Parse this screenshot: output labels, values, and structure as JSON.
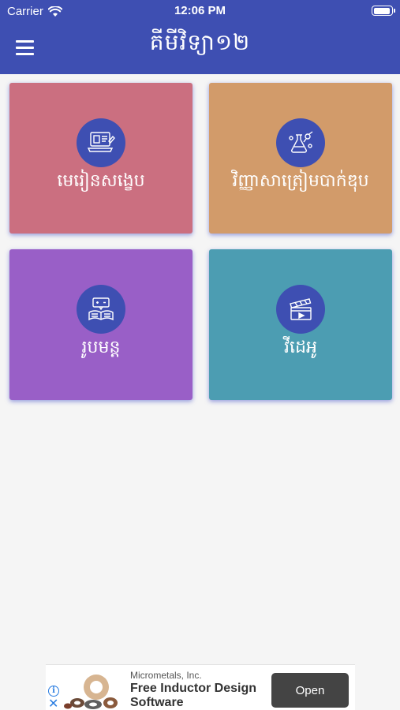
{
  "status_bar": {
    "carrier": "Carrier",
    "time": "12:06 PM"
  },
  "app_bar": {
    "title": "គីមីវិទ្យា១២"
  },
  "tiles": [
    {
      "label": "មេរៀនសង្ខេប",
      "icon": "book-laptop-icon",
      "color": "#cb6f80"
    },
    {
      "label": "វិញ្ញាសាត្រៀមបាក់ឌុប",
      "icon": "chemistry-flask-icon",
      "color": "#d29b6a"
    },
    {
      "label": "រូបមន្ត",
      "icon": "formula-book-icon",
      "color": "#995fc7"
    },
    {
      "label": "វីដេអូ",
      "icon": "clapperboard-icon",
      "color": "#4c9db2"
    }
  ],
  "colors": {
    "primary": "#3e4fb2",
    "background": "#f5f5f5"
  },
  "ad": {
    "advertiser": "Micrometals, Inc.",
    "headline": "Free Inductor Design Software",
    "cta": "Open",
    "info_icon": "info-icon",
    "close_icon": "close-icon"
  }
}
